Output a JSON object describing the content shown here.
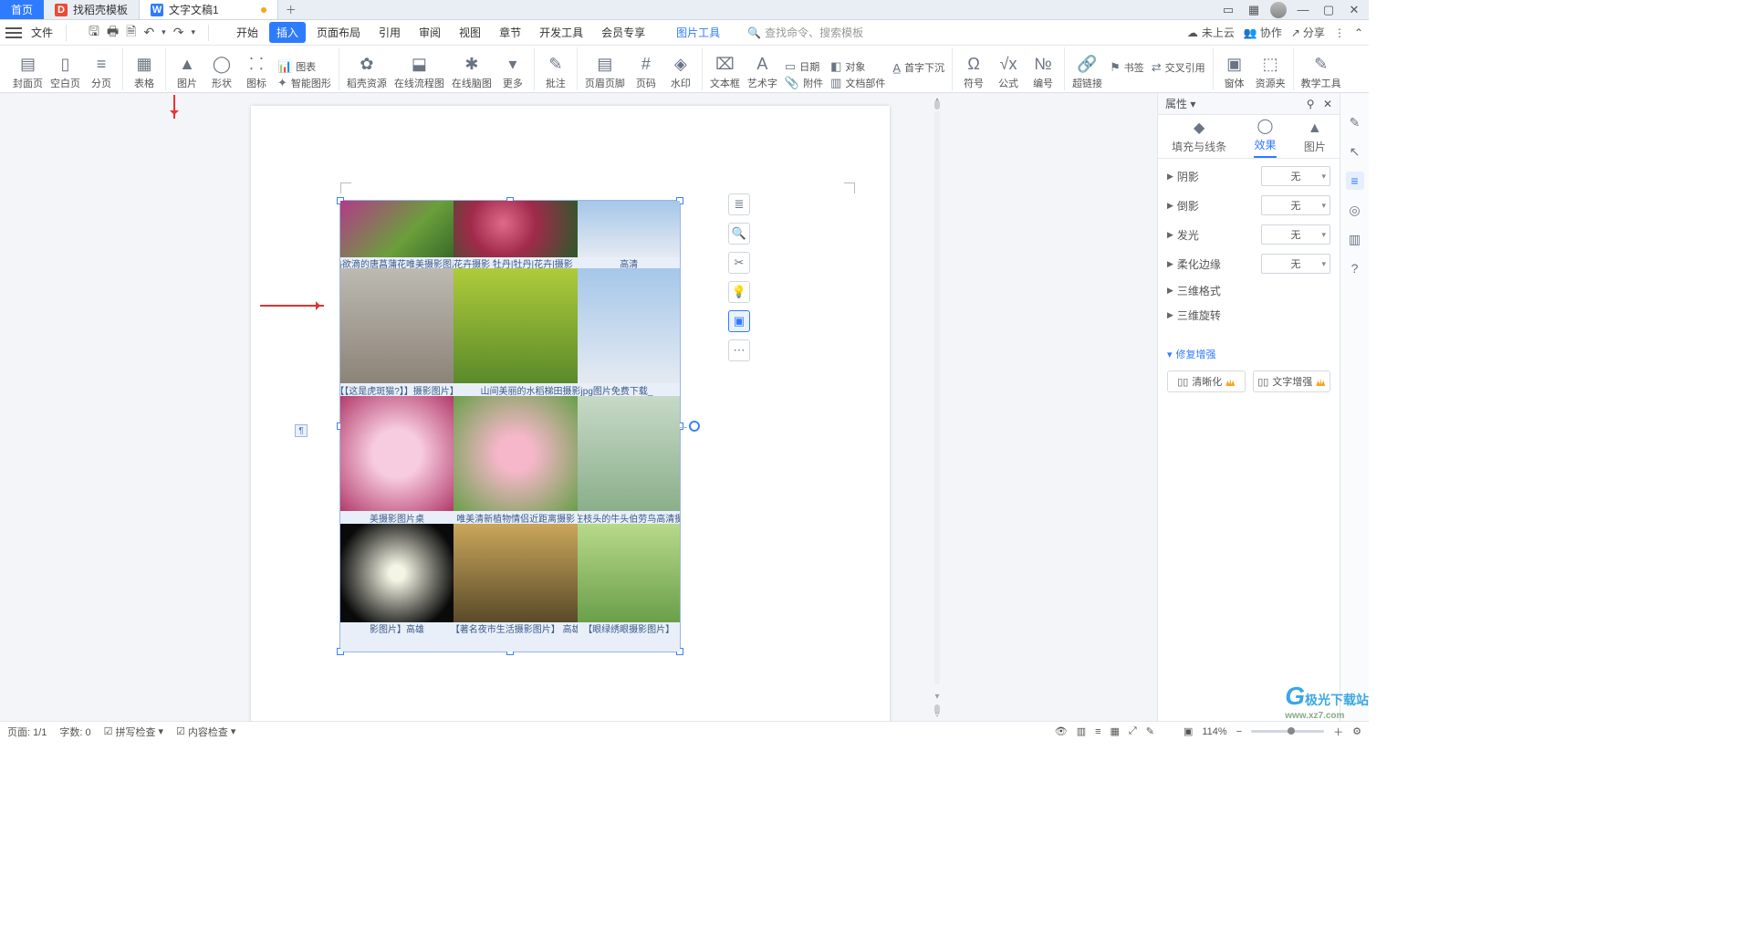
{
  "titlebar": {
    "home_tab": "首页",
    "tab1_label": "找稻壳模板",
    "tab2_label": "文字文稿1"
  },
  "menubar": {
    "file_label": "文件",
    "tabs": [
      "开始",
      "插入",
      "页面布局",
      "引用",
      "审阅",
      "视图",
      "章节",
      "开发工具",
      "会员专享"
    ],
    "active_tab_index": 1,
    "tool_tab": "图片工具",
    "search_placeholder": "查找命令、搜索模板",
    "cloud_label": "未上云",
    "collab_label": "协作",
    "share_label": "分享"
  },
  "ribbon": {
    "cover": "封面页",
    "blank": "空白页",
    "break": "分页",
    "table": "表格",
    "image": "图片",
    "shape": "形状",
    "icon": "图标",
    "chart": "图表",
    "smart": "智能图形",
    "docres": "稻壳资源",
    "flow": "在线流程图",
    "mind": "在线脑图",
    "more": "更多",
    "comment": "批注",
    "headerfooter": "页眉页脚",
    "pagenum": "页码",
    "watermark": "水印",
    "textbox": "文本框",
    "wordart": "艺术字",
    "date": "日期",
    "attach": "附件",
    "object": "对象",
    "dropcap": "首字下沉",
    "docpart": "文档部件",
    "symbol": "符号",
    "equation": "公式",
    "number": "编号",
    "hyperlink": "超链接",
    "bookmark": "书签",
    "crossref": "交叉引用",
    "window": "窗体",
    "resource": "资源夹",
    "teach": "教学工具"
  },
  "image_captions": {
    "r1c1": "热欲滴的唐菖蒲花唯美摄影图片",
    "r1c2": "花卉摄影 牡丹|牡丹|花卉|摄影_",
    "r1c3": "高清",
    "r2c1": "【【这是虎斑猫?】】摄影图片】",
    "r2c2": "山间美丽的水稻梯田摄影jpg图片免费下载_",
    "r3c1": "美摄影图片桌",
    "r3c2": "唯美清新植物情侣近距离摄影",
    "r3c3": "停落在枝头的牛头伯劳鸟高清摄影图",
    "r4c1": "影图片】高雄",
    "r4c2": "【著名夜市生活摄影图片】 高雄",
    "r4c3": "【眼绿绣眼摄影图片】"
  },
  "panel": {
    "title": "属性",
    "tabs": {
      "fill": "填充与线条",
      "effect": "效果",
      "picture": "图片"
    },
    "active_tab": "effect",
    "rows": {
      "shadow": "阴影",
      "reflection": "倒影",
      "glow": "发光",
      "soft": "柔化边缘",
      "d3format": "三维格式",
      "d3rotate": "三维旋转"
    },
    "dropdown_none": "无",
    "enhance_title": "修复增强",
    "enhance": {
      "sharpen": "清晰化",
      "textenh": "文字增强"
    }
  },
  "statusbar": {
    "page": "页面: 1/1",
    "words": "字数: 0",
    "spell": "拼写检查",
    "content": "内容检查",
    "zoom": "114%"
  },
  "watermark": {
    "brand": "极光下载站",
    "url": "www.xz7.com"
  }
}
